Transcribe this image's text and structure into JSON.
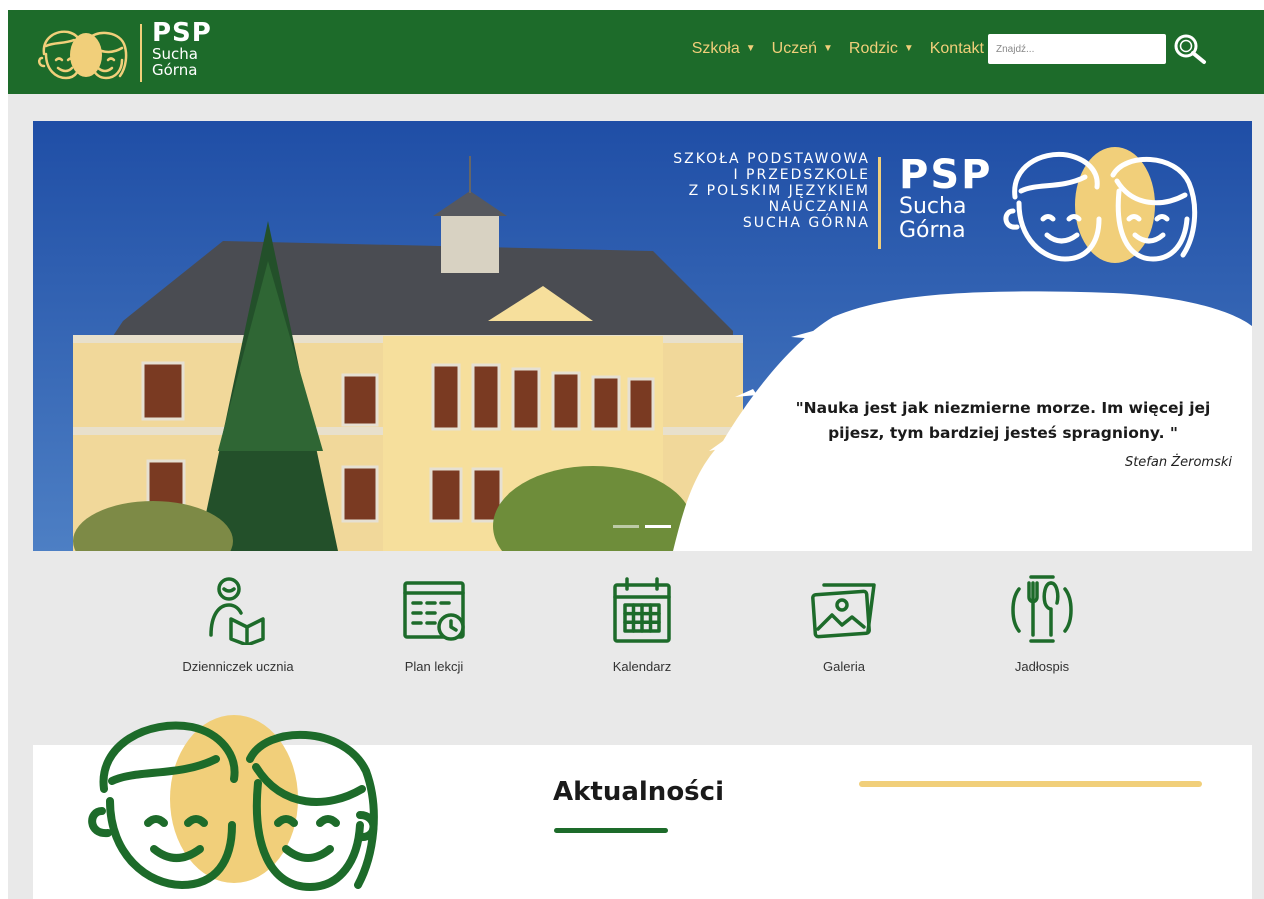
{
  "header": {
    "logo": {
      "title": "PSP",
      "line1": "Sucha",
      "line2": "Górna"
    },
    "nav": [
      {
        "label": "Szkoła",
        "has_dropdown": true
      },
      {
        "label": "Uczeń",
        "has_dropdown": true
      },
      {
        "label": "Rodzic",
        "has_dropdown": true
      },
      {
        "label": "Kontakt",
        "has_dropdown": false
      }
    ],
    "search": {
      "placeholder": "Znajdź...",
      "icon": "search-icon"
    }
  },
  "hero": {
    "school_name": [
      "SZKOŁA PODSTAWOWA",
      "I PRZEDSZKOLE",
      "Z POLSKIM JĘZYKIEM",
      "NAUCZANIA",
      "SUCHA GÓRNA"
    ],
    "logo": {
      "title": "PSP",
      "line1": "Sucha",
      "line2": "Górna"
    },
    "quote": "\"Nauka jest jak niezmierne morze. Im więcej jej pijesz, tym bardziej jesteś spragniony. \"",
    "author": "Stefan Żeromski",
    "slides": 2,
    "active_slide": 2
  },
  "quick_links": [
    {
      "label": "Dzienniczek ucznia",
      "icon": "student-book-icon"
    },
    {
      "label": "Plan lekcji",
      "icon": "schedule-icon"
    },
    {
      "label": "Kalendarz",
      "icon": "calendar-icon"
    },
    {
      "label": "Galeria",
      "icon": "gallery-icon"
    },
    {
      "label": "Jadłospis",
      "icon": "cutlery-icon"
    }
  ],
  "news": {
    "title": "Aktualności"
  },
  "colors": {
    "green": "#1d6b2a",
    "yellow": "#f1cf7a",
    "blue": "#2c58a8",
    "background": "#e9e9e9"
  }
}
